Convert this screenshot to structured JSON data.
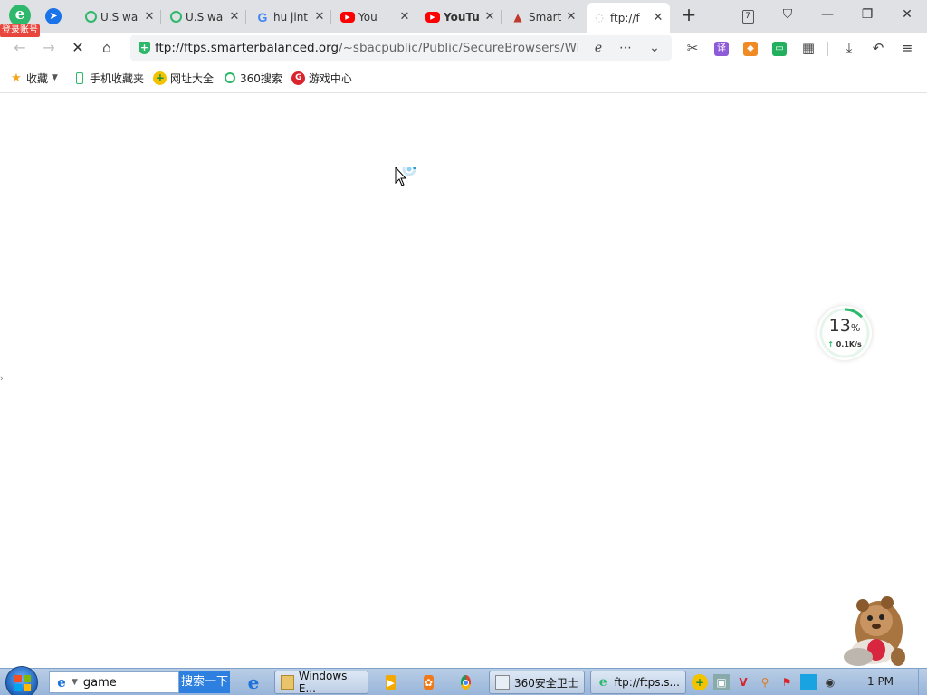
{
  "browser": {
    "login_badge": "登录账号",
    "tabs": [
      {
        "title": "U.S wa",
        "icon": "qihoo-search-icon"
      },
      {
        "title": "U.S wa",
        "icon": "qihoo-search-icon"
      },
      {
        "title": "hu jint",
        "icon": "google-icon"
      },
      {
        "title": "You",
        "icon": "youtube-icon"
      },
      {
        "title": "YouTu",
        "icon": "youtube-icon"
      },
      {
        "title": "Smart",
        "icon": "smarter-balanced-icon"
      },
      {
        "title": "ftp://f",
        "icon": "loading-icon",
        "active": true
      }
    ],
    "tab_count": "7",
    "address": {
      "host": "ftp://ftps.smarterbalanced.org",
      "path": "/~sbacpublic/Public/SecureBrowsers/Windows/S"
    }
  },
  "bookmarks": [
    {
      "label": "收藏",
      "icon": "star-icon"
    },
    {
      "label": "手机收藏夹",
      "icon": "phone-icon"
    },
    {
      "label": "网址大全",
      "icon": "nav-site-icon"
    },
    {
      "label": "360搜索",
      "icon": "qihoo-search-icon"
    },
    {
      "label": "游戏中心",
      "icon": "game-center-icon"
    }
  ],
  "speed_widget": {
    "percent": "13",
    "percent_sign": "%",
    "percent_value": 13,
    "rate": "0.1K/s",
    "ring_color": "#2db86b"
  },
  "taskbar": {
    "search_query": "game",
    "search_button": "搜索一下",
    "items": [
      {
        "label": "Windows E...",
        "icon": "folder-icon"
      },
      {
        "label": "360安全卫士",
        "icon": "shield-icon"
      },
      {
        "label": "ftp://ftps.s...",
        "icon": "browser-360-icon"
      }
    ],
    "clock": "1 PM"
  }
}
